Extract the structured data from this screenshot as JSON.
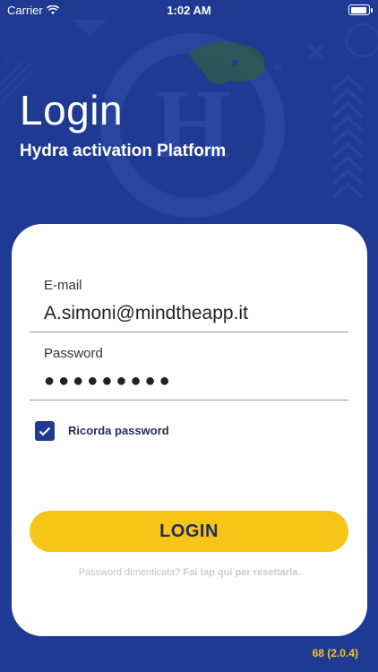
{
  "status_bar": {
    "carrier": "Carrier",
    "time": "1:02 AM"
  },
  "header": {
    "title": "Login",
    "subtitle": "Hydra activation Platform",
    "logo_letter": "H"
  },
  "form": {
    "email": {
      "label": "E-mail",
      "value": "A.simoni@mindtheapp.it"
    },
    "password": {
      "label": "Password",
      "value": "●●●●●●●●●"
    },
    "remember": {
      "label": "Ricorda password",
      "checked": true
    },
    "login_button": "LOGIN",
    "forgot": {
      "prefix": "Password dimenticata?",
      "action": "Fai tap qui per resettarla."
    }
  },
  "footer": {
    "version": "68 (2.0.4)"
  },
  "colors": {
    "background": "#1f3a93",
    "accent": "#f7c518",
    "card": "#ffffff"
  }
}
